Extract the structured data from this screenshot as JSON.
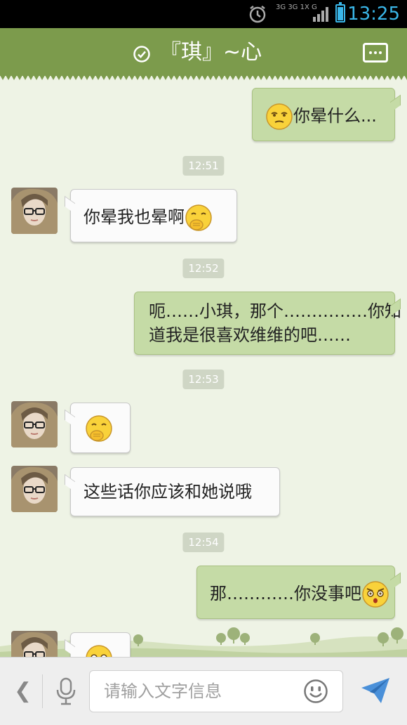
{
  "status_bar": {
    "time": "13:25",
    "network": [
      "3G",
      "3G",
      "1X",
      "G"
    ]
  },
  "header": {
    "title": "『琪』~心"
  },
  "messages": [
    {
      "side": "out",
      "text": "你晕什么...",
      "emoji": "dizzy-face"
    },
    {
      "timestamp": "12:51"
    },
    {
      "side": "in",
      "text": "你晕我也晕啊",
      "emoji": "shy-face"
    },
    {
      "timestamp": "12:52"
    },
    {
      "side": "out",
      "text": "呃……小琪，那个……………你知道我是很喜欢维维的吧……"
    },
    {
      "timestamp": "12:53"
    },
    {
      "side": "in",
      "text": "",
      "emoji": "shy-face"
    },
    {
      "side": "in",
      "text": "这些话你应该和她说哦"
    },
    {
      "timestamp": "12:54"
    },
    {
      "side": "out",
      "text": "那…………你没事吧",
      "emoji": "surprised-face"
    },
    {
      "side": "in",
      "text": "",
      "emoji": "surprised-face"
    }
  ],
  "labels": {
    "msg1": "你晕什么...",
    "ts1": "12:51",
    "msg2": "你晕我也晕啊",
    "ts2": "12:52",
    "msg3_line1": "呃……小琪，那个……………你知",
    "msg3_line2": "道我是很喜欢维维的吧……",
    "ts3": "12:53",
    "msg5": "这些话你应该和她说哦",
    "ts4": "12:54",
    "msg6": "那…………你没事吧"
  },
  "composer": {
    "placeholder": "请输入文字信息"
  },
  "colors": {
    "header": "#7c9b4c",
    "background": "#eef3e5",
    "bubble_out": "#c5dba6",
    "bubble_in": "#fbfbfb",
    "status_accent": "#3ab6e8"
  }
}
